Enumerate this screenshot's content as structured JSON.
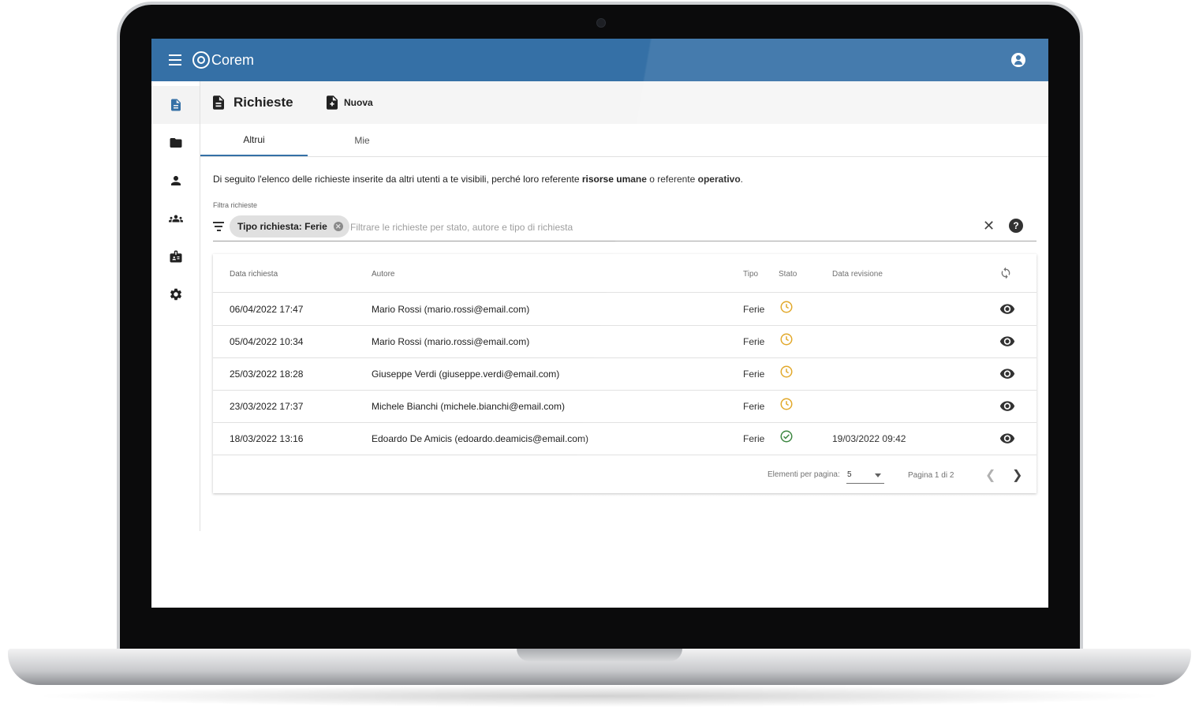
{
  "app": {
    "name": "Corem"
  },
  "page": {
    "title": "Richieste",
    "new_label": "Nuova"
  },
  "tabs": [
    {
      "label": "Altrui"
    },
    {
      "label": "Mie"
    }
  ],
  "intro": {
    "part1": "Di seguito l'elenco delle richieste inserite da altri utenti a te visibili, perché loro referente ",
    "bold1": "risorse umane",
    "part2": " o referente ",
    "bold2": "operativo",
    "part3": "."
  },
  "filter": {
    "label": "Filtra richieste",
    "chip": "Tipo richiesta: Ferie",
    "placeholder": "Filtrare le richieste per stato, autore e tipo di richiesta"
  },
  "table": {
    "headers": {
      "date": "Data richiesta",
      "author": "Autore",
      "type": "Tipo",
      "status": "Stato",
      "review": "Data revisione"
    },
    "rows": [
      {
        "date": "06/04/2022 17:47",
        "author": "Mario Rossi (mario.rossi@email.com)",
        "type": "Ferie",
        "status": "pending",
        "review": ""
      },
      {
        "date": "05/04/2022 10:34",
        "author": "Mario Rossi (mario.rossi@email.com)",
        "type": "Ferie",
        "status": "pending",
        "review": ""
      },
      {
        "date": "25/03/2022 18:28",
        "author": "Giuseppe Verdi (giuseppe.verdi@email.com)",
        "type": "Ferie",
        "status": "pending",
        "review": ""
      },
      {
        "date": "23/03/2022 17:37",
        "author": "Michele Bianchi (michele.bianchi@email.com)",
        "type": "Ferie",
        "status": "pending",
        "review": ""
      },
      {
        "date": "18/03/2022 13:16",
        "author": "Edoardo De Amicis (edoardo.deamicis@email.com)",
        "type": "Ferie",
        "status": "approved",
        "review": "19/03/2022 09:42"
      }
    ],
    "footer": {
      "per_page_label": "Elementi per pagina:",
      "per_page": "5",
      "page_info": "Pagina 1 di 2"
    }
  },
  "colors": {
    "primary": "#3570a6",
    "pending": "#e0a21a",
    "approved": "#2e7d32"
  },
  "icons": {
    "nav": [
      "document-icon",
      "folder-icon",
      "person-icon",
      "group-icon",
      "badge-icon",
      "gear-icon"
    ],
    "status": {
      "pending": "clock-icon",
      "approved": "check-circle-icon"
    }
  }
}
